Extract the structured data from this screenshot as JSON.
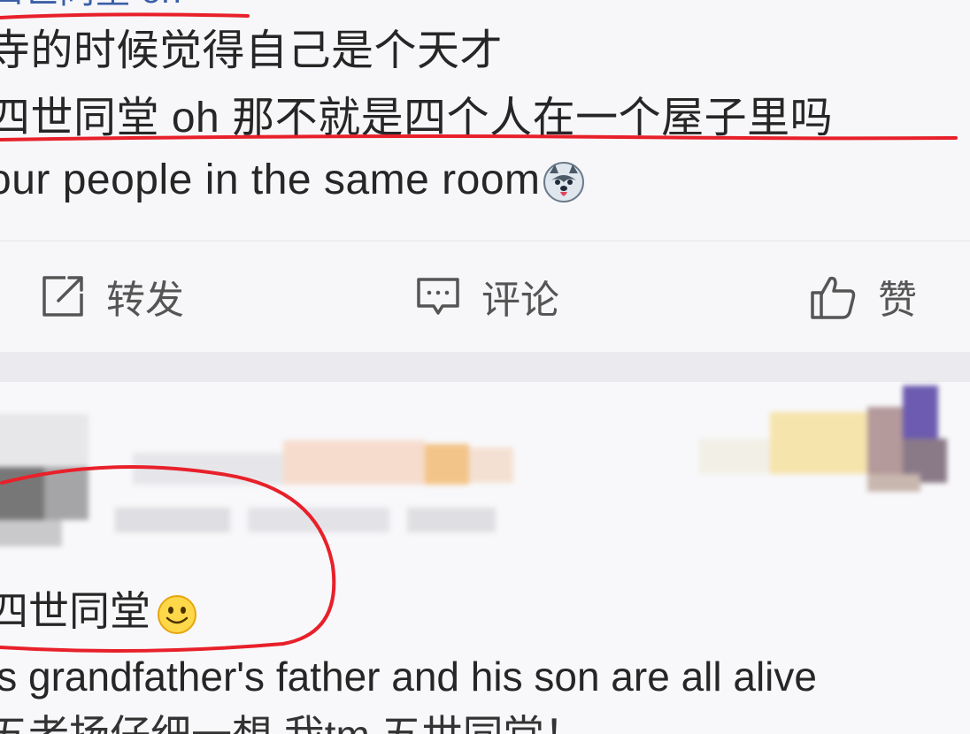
{
  "post": {
    "line0": "四世同堂 oh",
    "line1": "寺的时候觉得自己是个天才",
    "line2": "四世同堂 oh 那不就是四个人在一个屋子里吗",
    "line3": "our people in the same room",
    "emoji_name": "husky-dog-emoji"
  },
  "actions": {
    "repost_label": "转发",
    "comment_label": "评论",
    "like_label": "赞"
  },
  "comment": {
    "line1": "四世同堂",
    "line2": "is grandfather's father and his son are all alive",
    "line3": "五老扬仔细一想 我tm 五世同堂！"
  },
  "colors": {
    "annotation_red": "#e8202a",
    "text": "#262626",
    "icon_gray": "#555555",
    "divider": "#ebebef"
  }
}
